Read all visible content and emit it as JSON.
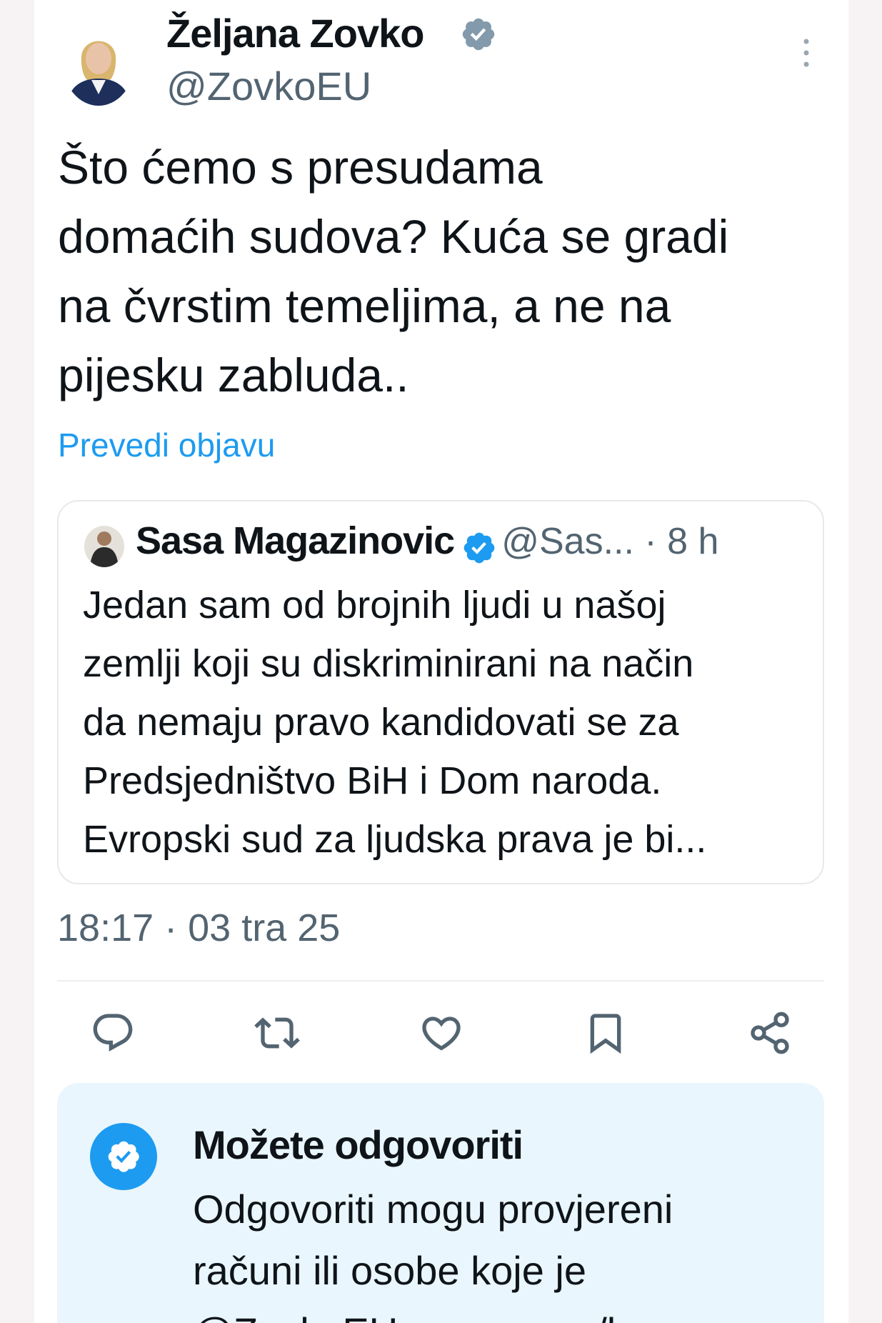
{
  "tweet": {
    "display_name": "Željana Zovko",
    "handle": "@ZovkoEU",
    "text_lines": [
      "Što ćemo s presudama",
      "domaćih sudova? Kuća se gradi",
      "na čvrstim temeljima, a ne na",
      "pijesku zabluda.."
    ],
    "translate_label": "Prevedi objavu",
    "timestamp": "18:17 · 03 tra 25"
  },
  "quoted": {
    "display_name": "Sasa Magazinovic",
    "meta": "@Sas... · 8 h",
    "text_lines": [
      "Jedan sam od brojnih ljudi u našoj",
      "zemlji koji su diskriminirani na način",
      "da nemaju pravo kandidovati se za",
      "Predsjedništvo BiH i Dom naroda.",
      "Evropski sud za ljudska prava je bi..."
    ]
  },
  "actions": [
    "reply-icon",
    "repost-icon",
    "like-icon",
    "bookmark-icon",
    "share-icon"
  ],
  "notice": {
    "title": "Možete odgovoriti",
    "body_lines": [
      "Odgovoriti mogu provjereni",
      "računi ili osobe koje je",
      "@ZovkoEU spomenuo/la"
    ]
  },
  "colors": {
    "accent": "#1d9bf0",
    "secondary_text": "#536471",
    "notice_background": "#e9f6fd",
    "verified_gray": "#829aab"
  }
}
